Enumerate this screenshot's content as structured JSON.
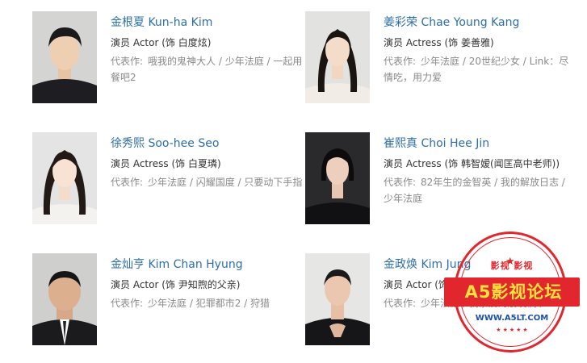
{
  "cast": [
    {
      "name": "金根夏 Kun-ha Kim",
      "role": "演员 Actor (饰 白度炫)",
      "works_label": "代表作:",
      "works": "哦我的鬼神大人 / 少年法庭 / 一起用餐吧2",
      "photo_icon": "actor-photo"
    },
    {
      "name": "姜彩荣 Chae Young Kang",
      "role": "演员 Actress (饰 姜善雅)",
      "works_label": "代表作:",
      "works": "少年法庭 / 20世纪少女 / Link：尽情吃，用力爱",
      "photo_icon": "actress-photo"
    },
    {
      "name": "徐秀熙 Soo-hee Seo",
      "role": "演员 Actress (饰 白夏璘)",
      "works_label": "代表作:",
      "works": "少年法庭 / 闪耀国度 / 只要动下手指",
      "photo_icon": "actress-photo"
    },
    {
      "name": "崔熙真 Choi Hee Jin",
      "role": "演员 Actress (饰 韩智嫒(闻匡高中老师))",
      "works_label": "代表作:",
      "works": "82年生的金智英 / 我的解放日志 / 少年法庭",
      "photo_icon": "actress-photo"
    },
    {
      "name": "金灿亨 Kim Chan Hyung",
      "role": "演员 Actor (饰 尹知煦的父亲)",
      "works_label": "代表作:",
      "works": "少年法庭 / 犯罪都市2 / 狩猎",
      "photo_icon": "actor-photo"
    },
    {
      "name": "金政焕 Kim Jung",
      "role": "演员 Actor (饰 检察",
      "works_label": "代表作:",
      "works": "少年法庭 / 我亲爱的朋友们 / Live",
      "photo_icon": "actor-photo"
    }
  ],
  "watermark": {
    "top_text": "影视 影视",
    "main_text": "A5影视论坛",
    "url": "WWW.A5LT.COM",
    "colors": {
      "red": "#e2262e",
      "yellow": "#ffe23d",
      "blue": "#1b4fa8"
    }
  },
  "colors": {
    "link": "#2f6fa8",
    "role": "#333333",
    "muted": "#8a8a8a"
  }
}
